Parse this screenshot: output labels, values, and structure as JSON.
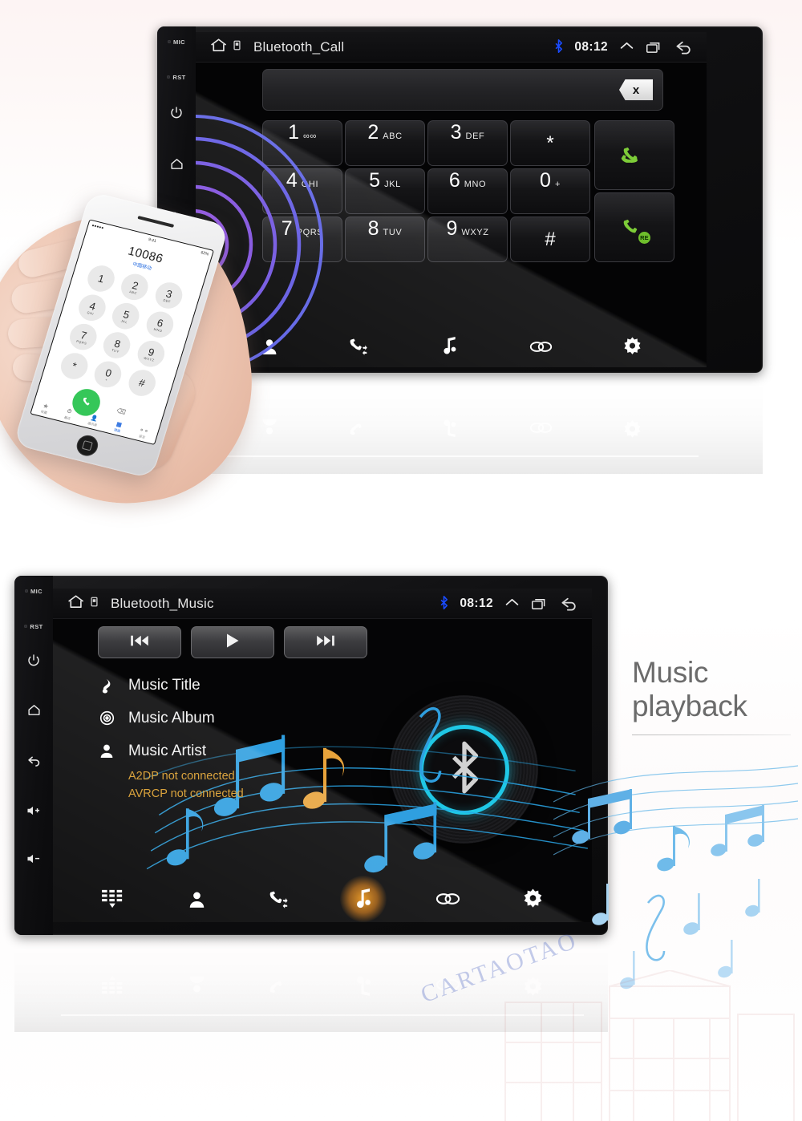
{
  "page": {
    "watermark": "CARTAOTAO"
  },
  "call_unit": {
    "bezel": {
      "mic_label": "MIC",
      "rst_label": "RST",
      "icons": [
        "power-icon",
        "home-icon",
        "back-icon",
        "volume-up-icon"
      ]
    },
    "statusbar": {
      "home_icon": "home-icon",
      "cast_icon": "cast-icon",
      "title": "Bluetooth_Call",
      "bluetooth_icon": "bluetooth-icon",
      "time": "08:12",
      "chevron_icon": "chevron-up-icon",
      "recents_icon": "recents-icon",
      "back_icon": "back-arrow-icon"
    },
    "number_input": {
      "value": "",
      "placeholder": "",
      "clear_label": "x"
    },
    "keypad": [
      {
        "digit": "1",
        "letters": "∞∞"
      },
      {
        "digit": "2",
        "letters": "ABC"
      },
      {
        "digit": "3",
        "letters": "DEF"
      },
      {
        "digit": "*",
        "letters": ""
      },
      {
        "digit": "4",
        "letters": "GHI"
      },
      {
        "digit": "5",
        "letters": "JKL"
      },
      {
        "digit": "6",
        "letters": "MNO"
      },
      {
        "digit": "0",
        "letters": "+"
      },
      {
        "digit": "7",
        "letters": "PQRS"
      },
      {
        "digit": "8",
        "letters": "TUV"
      },
      {
        "digit": "9",
        "letters": "WXYZ"
      },
      {
        "digit": "#",
        "letters": ""
      }
    ],
    "call_buttons": [
      {
        "name": "dial-button",
        "badge": ""
      },
      {
        "name": "redial-button",
        "badge": "RE"
      }
    ],
    "navbar": [
      {
        "icon": "contacts-icon",
        "label": "Contacts"
      },
      {
        "icon": "call-history-icon",
        "label": "Call history"
      },
      {
        "icon": "music-icon",
        "label": "Music"
      },
      {
        "icon": "link-icon",
        "label": "Pairing"
      },
      {
        "icon": "settings-gear-icon",
        "label": "Settings"
      }
    ],
    "colors": {
      "handset_green": "#7dcc38",
      "bluetooth_blue": "#1a4bff",
      "wave_purple": "#7a49d8"
    }
  },
  "phone": {
    "number": "10086",
    "carrier_note": "中国移动",
    "status_left": "●●●●●",
    "status_time": "9:41",
    "status_right": "62%",
    "keys": [
      {
        "digit": "1",
        "letters": ""
      },
      {
        "digit": "2",
        "letters": "ABC"
      },
      {
        "digit": "3",
        "letters": "DEF"
      },
      {
        "digit": "4",
        "letters": "GHI"
      },
      {
        "digit": "5",
        "letters": "JKL"
      },
      {
        "digit": "6",
        "letters": "MNO"
      },
      {
        "digit": "7",
        "letters": "PQRS"
      },
      {
        "digit": "8",
        "letters": "TUV"
      },
      {
        "digit": "9",
        "letters": "WXYZ"
      },
      {
        "digit": "*",
        "letters": ""
      },
      {
        "digit": "0",
        "letters": "+"
      },
      {
        "digit": "#",
        "letters": ""
      }
    ],
    "call_icon": "phone-call-icon",
    "tabs": [
      {
        "icon": "star-icon",
        "label": "收藏"
      },
      {
        "icon": "clock-icon",
        "label": "最近"
      },
      {
        "icon": "contacts-icon",
        "label": "通讯录"
      },
      {
        "icon": "keypad-icon",
        "label": "键盘"
      },
      {
        "icon": "voicemail-icon",
        "label": "留言"
      }
    ]
  },
  "music_unit": {
    "bezel": {
      "mic_label": "MIC",
      "rst_label": "RST",
      "icons": [
        "power-icon",
        "home-icon",
        "back-icon",
        "volume-up-icon",
        "volume-down-icon"
      ]
    },
    "statusbar": {
      "home_icon": "home-icon",
      "cast_icon": "cast-icon",
      "title": "Bluetooth_Music",
      "bluetooth_icon": "bluetooth-icon",
      "time": "08:12",
      "chevron_icon": "chevron-up-icon",
      "recents_icon": "recents-icon",
      "back_icon": "back-arrow-icon"
    },
    "transport": [
      {
        "icon": "previous-track-icon",
        "label": "Previous"
      },
      {
        "icon": "play-icon",
        "label": "Play"
      },
      {
        "icon": "next-track-icon",
        "label": "Next"
      }
    ],
    "track": [
      {
        "icon": "music-note-icon",
        "text": "Music Title"
      },
      {
        "icon": "album-disc-icon",
        "text": "Music Album"
      },
      {
        "icon": "artist-person-icon",
        "text": "Music Artist"
      }
    ],
    "status_messages": [
      "A2DP not connected",
      "AVRCP not connected"
    ],
    "navbar": [
      {
        "icon": "keypad-icon",
        "label": "Keypad",
        "active": false
      },
      {
        "icon": "contacts-icon",
        "label": "Contacts",
        "active": false
      },
      {
        "icon": "call-history-icon",
        "label": "Call history",
        "active": false
      },
      {
        "icon": "music-icon",
        "label": "Music",
        "active": true
      },
      {
        "icon": "link-icon",
        "label": "Pairing",
        "active": false
      },
      {
        "icon": "settings-gear-icon",
        "label": "Settings",
        "active": false
      }
    ],
    "disc": {
      "icon": "bluetooth-icon",
      "ring_color": "#1fc8e6"
    },
    "colors": {
      "warning_orange": "#d79a29",
      "active_glow": "#e87d0c",
      "bluetooth_blue": "#1a4bff"
    }
  },
  "caption": {
    "line1": "Music",
    "line2": "playback"
  }
}
